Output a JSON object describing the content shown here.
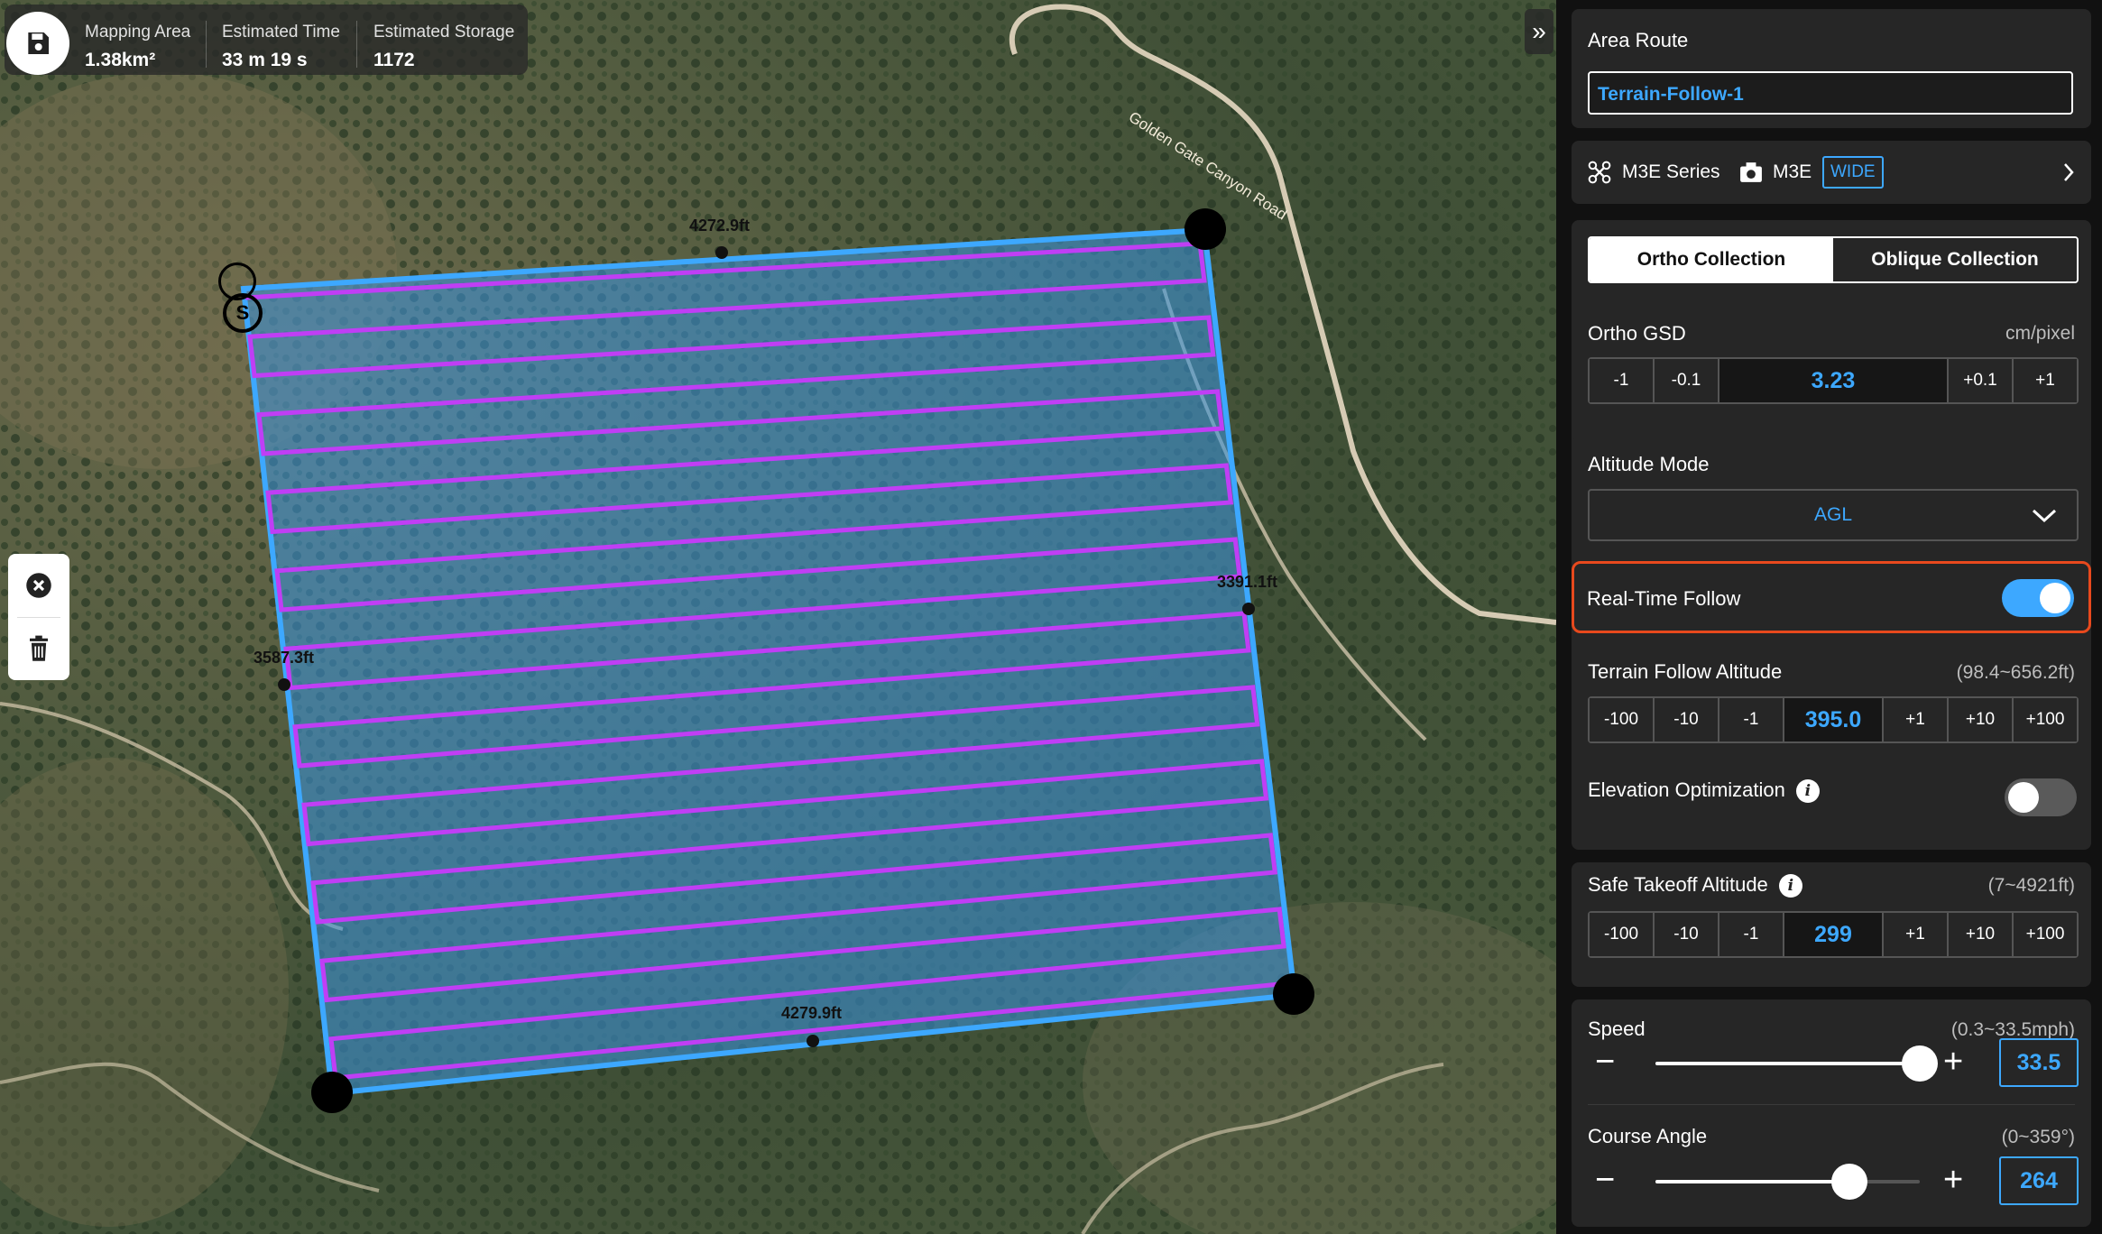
{
  "stats": {
    "mapping_area": {
      "label": "Mapping Area",
      "value": "1.38km²"
    },
    "estimated_time": {
      "label": "Estimated Time",
      "value": "33 m 19 s"
    },
    "estimated_storage": {
      "label": "Estimated Storage",
      "value": "1172"
    }
  },
  "map": {
    "point_labels": [
      "4272.9ft",
      "3391.1ft",
      "3587.3ft",
      "4279.9ft"
    ],
    "start_marker": "S",
    "road_label": "Golden Gate Canyon Road",
    "colors": {
      "area_fill": "#3b95e0",
      "area_border": "#3da8ff",
      "route": "#c03ef5"
    }
  },
  "panel": {
    "area_route": {
      "title": "Area Route",
      "name": "Terrain-Follow-1"
    },
    "device": {
      "drone": "M3E Series",
      "camera": "M3E",
      "lens": "WIDE"
    },
    "collection": {
      "ortho": "Ortho Collection",
      "oblique": "Oblique Collection",
      "selected": "Ortho Collection"
    },
    "ortho_gsd": {
      "label": "Ortho GSD",
      "unit": "cm/pixel",
      "buttons_left": [
        "-1",
        "-0.1"
      ],
      "value": "3.23",
      "buttons_right": [
        "+0.1",
        "+1"
      ]
    },
    "altitude_mode": {
      "label": "Altitude Mode",
      "value": "AGL"
    },
    "real_time_follow": {
      "label": "Real-Time Follow",
      "enabled": true
    },
    "terrain_follow_altitude": {
      "label": "Terrain Follow Altitude",
      "range": "(98.4~656.2ft)",
      "buttons_left": [
        "-100",
        "-10",
        "-1"
      ],
      "value": "395.0",
      "buttons_right": [
        "+1",
        "+10",
        "+100"
      ]
    },
    "elevation_optimization": {
      "label": "Elevation Optimization",
      "info": "i",
      "enabled": false
    },
    "safe_takeoff_altitude": {
      "label": "Safe Takeoff Altitude",
      "info": "i",
      "range": "(7~4921ft)",
      "buttons_left": [
        "-100",
        "-10",
        "-1"
      ],
      "value": "299",
      "buttons_right": [
        "+1",
        "+10",
        "+100"
      ]
    },
    "speed": {
      "label": "Speed",
      "range": "(0.3~33.5mph)",
      "value": "33.5",
      "fraction": 1.0
    },
    "course_angle": {
      "label": "Course Angle",
      "range": "(0~359°)",
      "value": "264",
      "fraction": 0.7354
    },
    "accent_color": "#3da8ff",
    "highlight_color": "#e8491d"
  }
}
